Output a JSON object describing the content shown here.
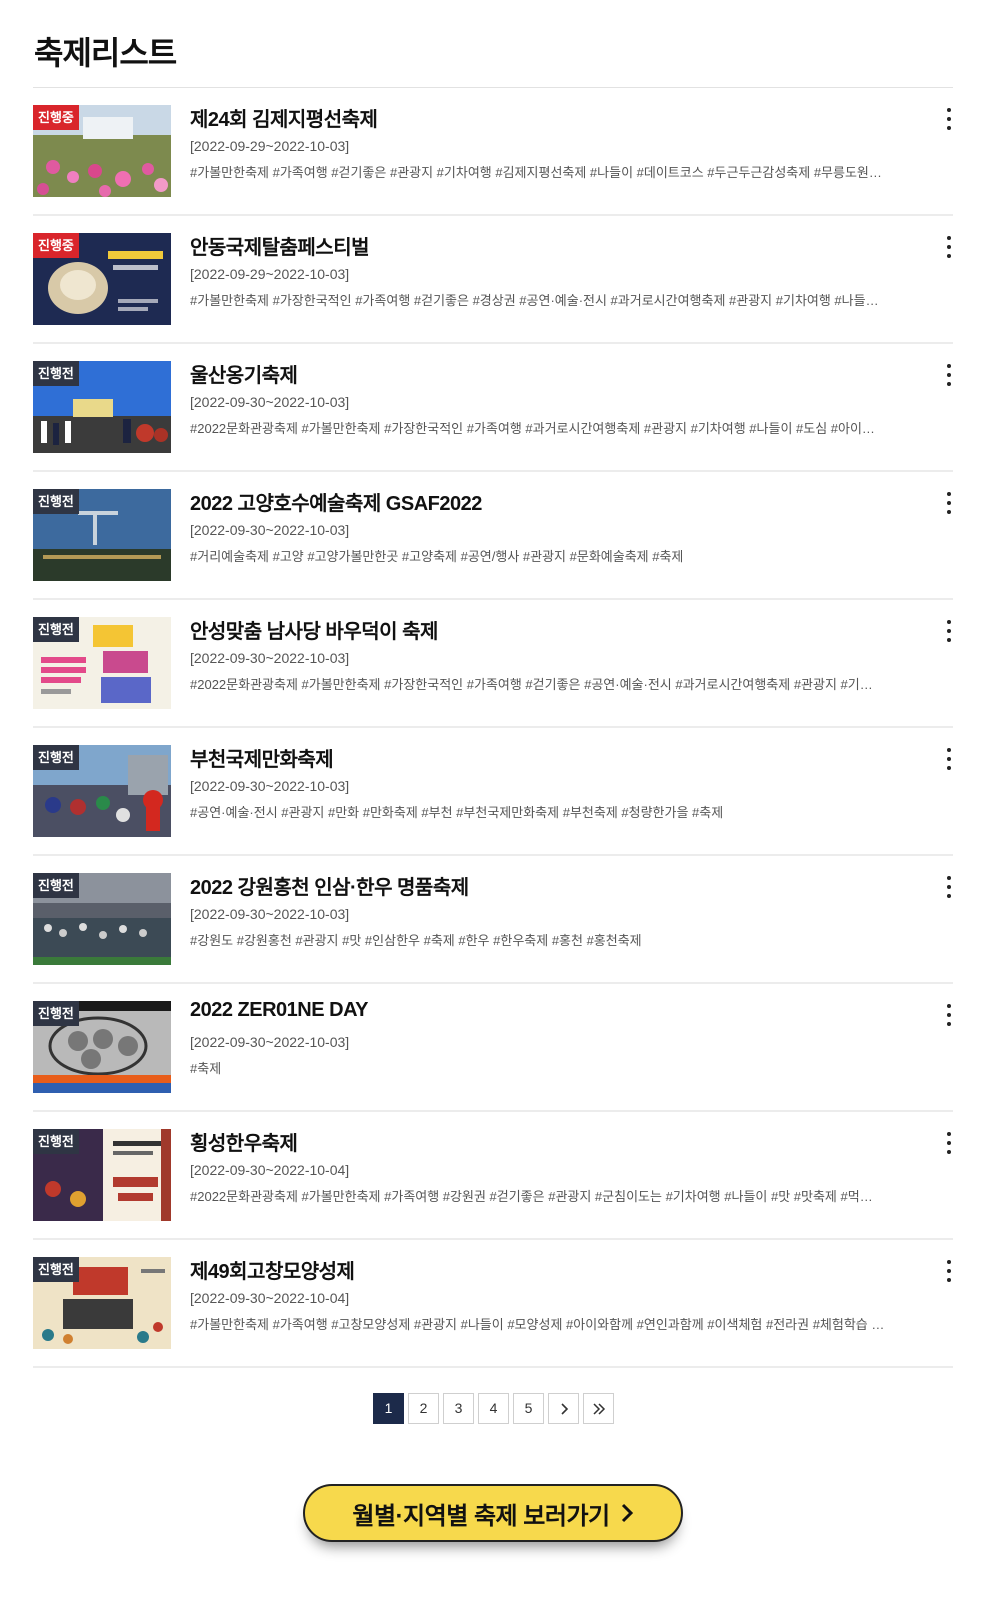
{
  "page": {
    "title": "축제리스트"
  },
  "status_colors": {
    "ongoing": "#d9252b",
    "upcoming": "#2f3544"
  },
  "festivals": [
    {
      "status": "진행중",
      "title": "제24회 김제지평선축제",
      "period": "[2022-09-29~2022-10-03]",
      "tags": "#가볼만한축제 #가족여행 #걷기좋은 #관광지 #기차여행 #김제지평선축제 #나들이 #데이트코스 #두근두근감성축제 #무릉도원…"
    },
    {
      "status": "진행중",
      "title": "안동국제탈춤페스티벌",
      "period": "[2022-09-29~2022-10-03]",
      "tags": "#가볼만한축제 #가장한국적인 #가족여행 #걷기좋은 #경상권 #공연·예술·전시 #과거로시간여행축제 #관광지 #기차여행 #나들…"
    },
    {
      "status": "진행전",
      "title": "울산옹기축제",
      "period": "[2022-09-30~2022-10-03]",
      "tags": "#2022문화관광축제 #가볼만한축제 #가장한국적인 #가족여행 #과거로시간여행축제 #관광지 #기차여행 #나들이 #도심 #아이…"
    },
    {
      "status": "진행전",
      "title": "2022 고양호수예술축제 GSAF2022",
      "period": "[2022-09-30~2022-10-03]",
      "tags": "#거리예술축제 #고양 #고양가볼만한곳 #고양축제 #공연/행사 #관광지 #문화예술축제 #축제"
    },
    {
      "status": "진행전",
      "title": "안성맞춤 남사당 바우덕이 축제",
      "period": "[2022-09-30~2022-10-03]",
      "tags": "#2022문화관광축제 #가볼만한축제 #가장한국적인 #가족여행 #걷기좋은 #공연·예술·전시 #과거로시간여행축제 #관광지 #기…"
    },
    {
      "status": "진행전",
      "title": "부천국제만화축제",
      "period": "[2022-09-30~2022-10-03]",
      "tags": "#공연·예술·전시 #관광지 #만화 #만화축제 #부천 #부천국제만화축제 #부천축제 #청량한가을 #축제"
    },
    {
      "status": "진행전",
      "title": "2022 강원홍천 인삼·한우 명품축제",
      "period": "[2022-09-30~2022-10-03]",
      "tags": "#강원도 #강원홍천 #관광지 #맛 #인삼한우 #축제 #한우 #한우축제 #홍천 #홍천축제"
    },
    {
      "status": "진행전",
      "title": "2022 ZER01NE DAY",
      "period": "[2022-09-30~2022-10-03]",
      "tags": "#축제"
    },
    {
      "status": "진행전",
      "title": "횡성한우축제",
      "period": "[2022-09-30~2022-10-04]",
      "tags": "#2022문화관광축제 #가볼만한축제 #가족여행 #강원권 #걷기좋은 #관광지 #군침이도는 #기차여행 #나들이 #맛 #맛축제 #먹…"
    },
    {
      "status": "진행전",
      "title": "제49회고창모양성제",
      "period": "[2022-09-30~2022-10-04]",
      "tags": "#가볼만한축제 #가족여행 #고창모양성제 #관광지 #나들이 #모양성제 #아이와함께 #연인과함께 #이색체험 #전라권 #체험학습 …"
    }
  ],
  "pagination": {
    "pages": [
      "1",
      "2",
      "3",
      "4",
      "5"
    ],
    "current": "1",
    "next_icon": "chevron-right-icon",
    "last_icon": "double-chevron-right-icon"
  },
  "cta": {
    "label": "월별·지역별 축제 보러가기",
    "icon": "chevron-right-icon",
    "background": "#f7d94c"
  }
}
